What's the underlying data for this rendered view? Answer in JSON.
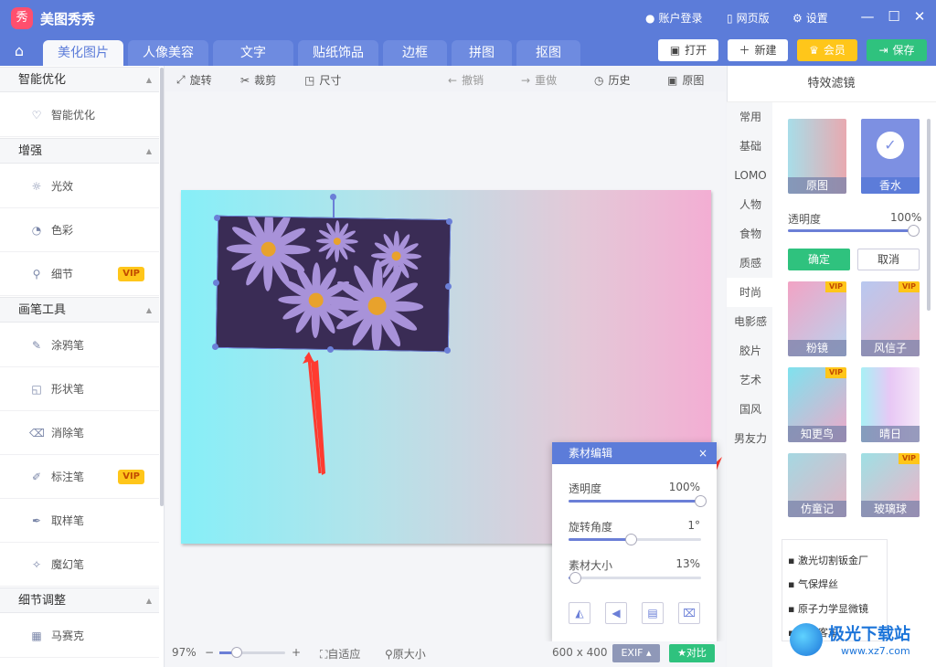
{
  "app": {
    "logo_glyph": "秀",
    "title": "美图秀秀"
  },
  "titlebar": {
    "login": "账户登录",
    "web": "网页版",
    "settings": "设置"
  },
  "tabs": [
    "美化图片",
    "人像美容",
    "文字",
    "贴纸饰品",
    "边框",
    "拼图",
    "抠图"
  ],
  "header_buttons": {
    "open": "打开",
    "new": "新建",
    "vip": "会员",
    "save": "保存"
  },
  "sidebar": {
    "sections": [
      "智能优化",
      "增强",
      "画笔工具",
      "细节调整"
    ],
    "items": {
      "smart": "智能优化",
      "light": "光效",
      "color": "色彩",
      "detail": "细节",
      "doodle": "涂鸦笔",
      "shape": "形状笔",
      "eraser": "消除笔",
      "mark": "标注笔",
      "picker": "取样笔",
      "magic": "魔幻笔",
      "mosaic": "马赛克"
    },
    "vip_badge": "VIP"
  },
  "toolbar": {
    "rotate": "旋转",
    "crop": "裁剪",
    "size": "尺寸",
    "undo": "撤销",
    "redo": "重做",
    "history": "历史",
    "original": "原图"
  },
  "bottom": {
    "zoom": "97%",
    "fit": "自适应",
    "actual": "原大小",
    "dims": "600 x 400",
    "exif": "EXIF",
    "compare": "对比",
    "minus": "−",
    "plus": "+"
  },
  "right_panel": {
    "title": "特效滤镜",
    "categories": [
      "常用",
      "基础",
      "LOMO",
      "人物",
      "食物",
      "质感",
      "时尚",
      "电影感",
      "胶片",
      "艺术",
      "国风",
      "男友力"
    ],
    "selected_category": "时尚",
    "filters_top": [
      "原图",
      "香水"
    ],
    "opacity_label": "透明度",
    "opacity_value": "100%",
    "opacity": 1.0,
    "confirm": "确定",
    "cancel": "取消",
    "filters": [
      "粉镜",
      "风信子",
      "知更鸟",
      "晴日",
      "仿童记",
      "玻璃球"
    ],
    "vip_badge": "VIP"
  },
  "ad": {
    "items": [
      "激光切割钣金厂",
      "气保焊丝",
      "原子力学显微镜",
      "普通客车"
    ]
  },
  "popup": {
    "title": "素材编辑",
    "close": "×",
    "opacity_label": "透明度",
    "opacity_value": "100%",
    "opacity": 1.0,
    "rotate_label": "旋转角度",
    "rotate_value": "1°",
    "rotate": 0.47,
    "size_label": "素材大小",
    "size_value": "13%",
    "size": 0.05
  },
  "colors": {
    "brand": "#5c7cd9",
    "confirm": "#2fc27e",
    "vip": "#ffc61a",
    "save": "#2fc27e",
    "arrow": "#ff3b30"
  },
  "watermark": {
    "text": "极光下载站",
    "url": "www.xz7.com"
  }
}
